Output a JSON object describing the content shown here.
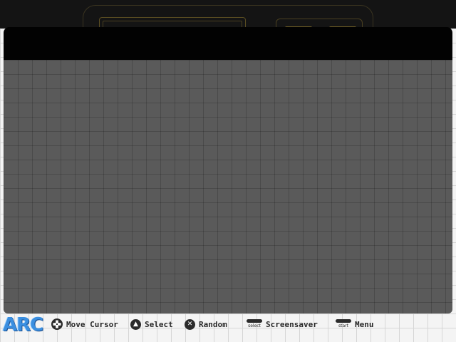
{
  "app": {
    "logo_text": "ARC"
  },
  "hints": {
    "move_cursor": {
      "icon": "dpad-icon",
      "label": "Move Cursor"
    },
    "select": {
      "icon": "a-button-icon",
      "glyph": "▲",
      "label": "Select"
    },
    "random": {
      "icon": "x-button-icon",
      "glyph": "✕",
      "label": "Random"
    },
    "screensaver": {
      "icon": "select-button-icon",
      "button_text": "select",
      "label": "Screensaver"
    },
    "menu": {
      "icon": "start-button-icon",
      "button_text": "start",
      "label": "Menu"
    }
  },
  "colors": {
    "top_bar": "#141414",
    "header_band": "#020202",
    "content_panel": "#5a5a5a",
    "logo": "#3b8fe0",
    "console_outline": "#5a4d22"
  }
}
